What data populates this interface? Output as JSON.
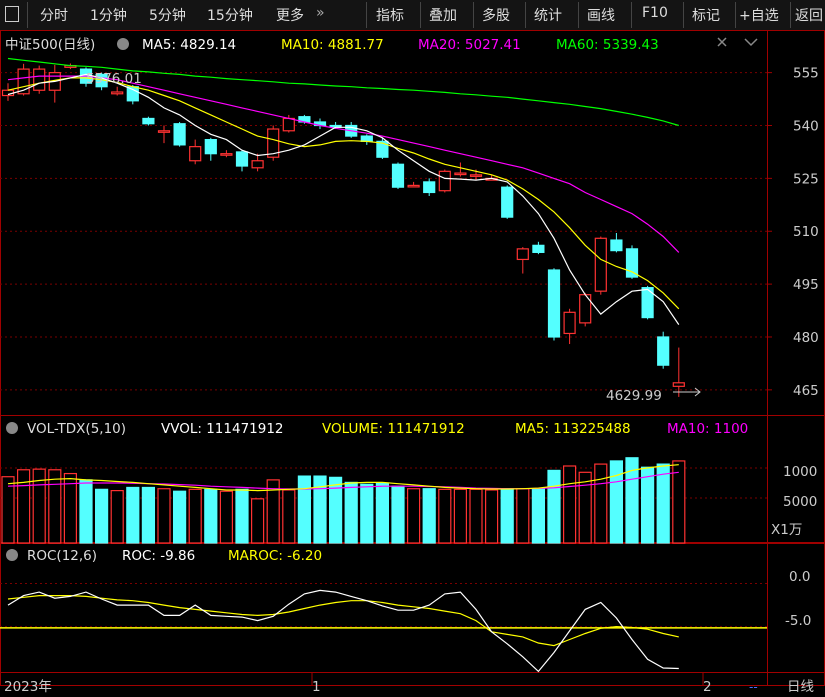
{
  "toolbar": {
    "layout_icon": "layout-icon",
    "items": [
      "分时",
      "1分钟",
      "5分钟",
      "15分钟",
      "更多",
      "指标",
      "叠加",
      "多股",
      "统计",
      "画线",
      "F10",
      "标记",
      "+自选",
      "返回"
    ]
  },
  "main_panel": {
    "title": "中证500(日线)",
    "indicators": [
      {
        "label": "MA5: 4829.14",
        "color": "#ffffff"
      },
      {
        "label": "MA10: 4881.77",
        "color": "#ffff00"
      },
      {
        "label": "MA20: 5027.41",
        "color": "#ff00ff"
      },
      {
        "label": "MA60: 5339.43",
        "color": "#00ff00"
      }
    ],
    "high_label": "5576.01",
    "low_label": "4629.99",
    "y_ticks": [
      "555",
      "540",
      "525",
      "510",
      "495",
      "480",
      "465"
    ]
  },
  "vol_panel": {
    "title": "VOL-TDX(5,10)",
    "indicators": [
      {
        "label": "VVOL: 111471912",
        "color": "#ffffff"
      },
      {
        "label": "VOLUME: 111471912",
        "color": "#ffff00"
      },
      {
        "label": "MA5: 113225488",
        "color": "#ffff00"
      },
      {
        "label": "MA10: 1100",
        "color": "#ff00ff"
      }
    ],
    "y_ticks": [
      "1000",
      "5000"
    ],
    "unit": "X1万"
  },
  "roc_panel": {
    "title": "ROC(12,6)",
    "indicators": [
      {
        "label": "ROC: -9.86",
        "color": "#ffffff"
      },
      {
        "label": "MAROC: -6.20",
        "color": "#ffff00"
      }
    ],
    "y_ticks": [
      "0.0",
      "-5.0"
    ]
  },
  "footer": {
    "x_labels": [
      "2023年",
      "1",
      "2"
    ],
    "right_label": "日线",
    "dash_label": "--"
  },
  "colors": {
    "up": "#ff3232",
    "down": "#54ffff",
    "ma5": "#ffffff",
    "ma10": "#ffff00",
    "ma20": "#ff00ff",
    "ma60": "#00ff00",
    "grid": "#7a0000",
    "axis": "#a00000"
  },
  "chart_data": {
    "type": "candlestick",
    "ylim": [
      4590,
      5600
    ],
    "candles": [
      {
        "o": 5485,
        "c": 5500,
        "h": 5520,
        "l": 5470
      },
      {
        "o": 5490,
        "c": 5560,
        "h": 5575,
        "l": 5485
      },
      {
        "o": 5500,
        "c": 5560,
        "h": 5570,
        "l": 5490
      },
      {
        "o": 5500,
        "c": 5550,
        "h": 5572,
        "l": 5465
      },
      {
        "o": 5565,
        "c": 5570,
        "h": 5576,
        "l": 5560
      },
      {
        "o": 5560,
        "c": 5520,
        "h": 5565,
        "l": 5510
      },
      {
        "o": 5545,
        "c": 5510,
        "h": 5550,
        "l": 5500
      },
      {
        "o": 5490,
        "c": 5495,
        "h": 5510,
        "l": 5485
      },
      {
        "o": 5510,
        "c": 5470,
        "h": 5515,
        "l": 5460
      },
      {
        "o": 5420,
        "c": 5405,
        "h": 5425,
        "l": 5400
      },
      {
        "o": 5385,
        "c": 5385,
        "h": 5400,
        "l": 5350
      },
      {
        "o": 5405,
        "c": 5345,
        "h": 5410,
        "l": 5340
      },
      {
        "o": 5300,
        "c": 5340,
        "h": 5360,
        "l": 5290
      },
      {
        "o": 5360,
        "c": 5320,
        "h": 5365,
        "l": 5300
      },
      {
        "o": 5320,
        "c": 5320,
        "h": 5330,
        "l": 5310
      },
      {
        "o": 5325,
        "c": 5285,
        "h": 5330,
        "l": 5270
      },
      {
        "o": 5280,
        "c": 5300,
        "h": 5320,
        "l": 5270
      },
      {
        "o": 5310,
        "c": 5390,
        "h": 5400,
        "l": 5300
      },
      {
        "o": 5385,
        "c": 5420,
        "h": 5430,
        "l": 5380
      },
      {
        "o": 5425,
        "c": 5410,
        "h": 5430,
        "l": 5405
      },
      {
        "o": 5410,
        "c": 5400,
        "h": 5420,
        "l": 5390
      },
      {
        "o": 5400,
        "c": 5395,
        "h": 5410,
        "l": 5390
      },
      {
        "o": 5400,
        "c": 5370,
        "h": 5410,
        "l": 5365
      },
      {
        "o": 5370,
        "c": 5355,
        "h": 5375,
        "l": 5345
      },
      {
        "o": 5355,
        "c": 5310,
        "h": 5365,
        "l": 5305
      },
      {
        "o": 5290,
        "c": 5225,
        "h": 5295,
        "l": 5220
      },
      {
        "o": 5230,
        "c": 5230,
        "h": 5240,
        "l": 5225
      },
      {
        "o": 5240,
        "c": 5210,
        "h": 5250,
        "l": 5200
      },
      {
        "o": 5215,
        "c": 5270,
        "h": 5275,
        "l": 5210
      },
      {
        "o": 5265,
        "c": 5265,
        "h": 5295,
        "l": 5255
      },
      {
        "o": 5260,
        "c": 5260,
        "h": 5275,
        "l": 5245
      },
      {
        "o": 5245,
        "c": 5250,
        "h": 5260,
        "l": 5245
      },
      {
        "o": 5225,
        "c": 5140,
        "h": 5230,
        "l": 5135
      },
      {
        "o": 5020,
        "c": 5050,
        "h": 5055,
        "l": 4980
      },
      {
        "o": 5060,
        "c": 5040,
        "h": 5070,
        "l": 5035
      },
      {
        "o": 4990,
        "c": 4800,
        "h": 4995,
        "l": 4790
      },
      {
        "o": 4810,
        "c": 4870,
        "h": 4880,
        "l": 4780
      },
      {
        "o": 4840,
        "c": 4920,
        "h": 4925,
        "l": 4830
      },
      {
        "o": 4930,
        "c": 5080,
        "h": 5085,
        "l": 4920
      },
      {
        "o": 5075,
        "c": 5045,
        "h": 5095,
        "l": 5040
      },
      {
        "o": 5050,
        "c": 4970,
        "h": 5060,
        "l": 4965
      },
      {
        "o": 4940,
        "c": 4855,
        "h": 4945,
        "l": 4850
      },
      {
        "o": 4800,
        "c": 4720,
        "h": 4815,
        "l": 4710
      },
      {
        "o": 4660,
        "c": 4670,
        "h": 4770,
        "l": 4630
      }
    ],
    "ma5": [
      5488,
      5500,
      5520,
      5525,
      5535,
      5545,
      5535,
      5520,
      5502,
      5480,
      5450,
      5430,
      5400,
      5375,
      5360,
      5330,
      5315,
      5320,
      5330,
      5345,
      5370,
      5395,
      5395,
      5385,
      5365,
      5330,
      5300,
      5270,
      5250,
      5248,
      5245,
      5250,
      5240,
      5200,
      5150,
      5080,
      4990,
      4920,
      4865,
      4900,
      4930,
      4935,
      4900,
      4835
    ],
    "ma10": [
      5500,
      5510,
      5520,
      5528,
      5535,
      5535,
      5530,
      5522,
      5510,
      5500,
      5485,
      5470,
      5450,
      5430,
      5410,
      5390,
      5370,
      5360,
      5348,
      5340,
      5345,
      5355,
      5357,
      5355,
      5350,
      5335,
      5322,
      5305,
      5290,
      5280,
      5270,
      5260,
      5245,
      5220,
      5190,
      5155,
      5110,
      5060,
      5020,
      5000,
      4985,
      4960,
      4925,
      4880
    ],
    "ma20": [
      5530,
      5535,
      5540,
      5540,
      5540,
      5540,
      5535,
      5530,
      5520,
      5510,
      5500,
      5490,
      5480,
      5470,
      5460,
      5450,
      5440,
      5430,
      5420,
      5410,
      5400,
      5392,
      5385,
      5378,
      5370,
      5360,
      5350,
      5340,
      5330,
      5320,
      5310,
      5300,
      5290,
      5280,
      5265,
      5250,
      5235,
      5210,
      5190,
      5170,
      5150,
      5120,
      5085,
      5040
    ],
    "ma60": [
      5590,
      5585,
      5580,
      5575,
      5570,
      5568,
      5565,
      5560,
      5555,
      5552,
      5548,
      5545,
      5540,
      5537,
      5533,
      5530,
      5527,
      5524,
      5520,
      5518,
      5515,
      5512,
      5510,
      5507,
      5505,
      5502,
      5500,
      5497,
      5494,
      5490,
      5487,
      5483,
      5480,
      5475,
      5470,
      5465,
      5460,
      5454,
      5448,
      5440,
      5432,
      5423,
      5413,
      5400
    ],
    "volume": {
      "ylim": [
        0,
        1600
      ],
      "values": [
        1050,
        1160,
        1170,
        1160,
        1100,
        1000,
        850,
        830,
        880,
        880,
        860,
        820,
        850,
        850,
        820,
        850,
        700,
        1000,
        840,
        1060,
        1060,
        1040,
        960,
        930,
        950,
        900,
        860,
        860,
        850,
        850,
        850,
        840,
        860,
        860,
        860,
        1150,
        1220,
        1120,
        1250,
        1300,
        1350,
        1200,
        1250,
        1300,
        1270
      ],
      "ma5": [
        940,
        960,
        990,
        1010,
        1020,
        1000,
        990,
        975,
        960,
        940,
        920,
        900,
        880,
        860,
        840,
        840,
        830,
        840,
        850,
        860,
        890,
        920,
        950,
        960,
        960,
        940,
        920,
        900,
        880,
        870,
        860,
        855,
        855,
        860,
        870,
        900,
        940,
        970,
        1010,
        1070,
        1150,
        1190,
        1220,
        1240,
        1260
      ],
      "ma10": [
        900,
        910,
        920,
        930,
        940,
        950,
        950,
        950,
        945,
        940,
        935,
        925,
        915,
        900,
        890,
        880,
        870,
        860,
        855,
        855,
        860,
        870,
        880,
        890,
        900,
        900,
        900,
        895,
        890,
        880,
        870,
        865,
        860,
        860,
        865,
        875,
        895,
        915,
        940,
        970,
        1010,
        1050,
        1090,
        1120,
        1150
      ]
    },
    "roc": {
      "ylim": [
        -10.5,
        1.8
      ],
      "roc": [
        -2.5,
        -1.4,
        -1.0,
        -1.7,
        -1.5,
        -1.0,
        -1.8,
        -2.5,
        -2.5,
        -2.5,
        -3.7,
        -3.7,
        -2.5,
        -3.7,
        -3.8,
        -3.9,
        -4.3,
        -3.8,
        -2.4,
        -1.2,
        -0.8,
        -1.0,
        -1.5,
        -2.0,
        -2.6,
        -3.1,
        -3.1,
        -2.5,
        -1.2,
        -1.0,
        -3.0,
        -5.6,
        -7.0,
        -8.5,
        -10.2,
        -8.0,
        -5.5,
        -3.0,
        -2.2,
        -4.0,
        -6.5,
        -8.8,
        -9.8,
        -9.86
      ],
      "maroc": [
        -1.8,
        -1.6,
        -1.4,
        -1.4,
        -1.4,
        -1.5,
        -1.7,
        -1.9,
        -2.0,
        -2.2,
        -2.5,
        -2.8,
        -3.0,
        -3.2,
        -3.4,
        -3.6,
        -3.7,
        -3.6,
        -3.3,
        -2.9,
        -2.5,
        -2.2,
        -2.0,
        -2.0,
        -2.2,
        -2.5,
        -2.7,
        -2.9,
        -3.2,
        -3.5,
        -4.3,
        -5.6,
        -5.9,
        -6.2,
        -6.9,
        -7.2,
        -6.5,
        -5.8,
        -5.2,
        -5.0,
        -5.1,
        -5.3,
        -5.8,
        -6.2
      ]
    }
  }
}
